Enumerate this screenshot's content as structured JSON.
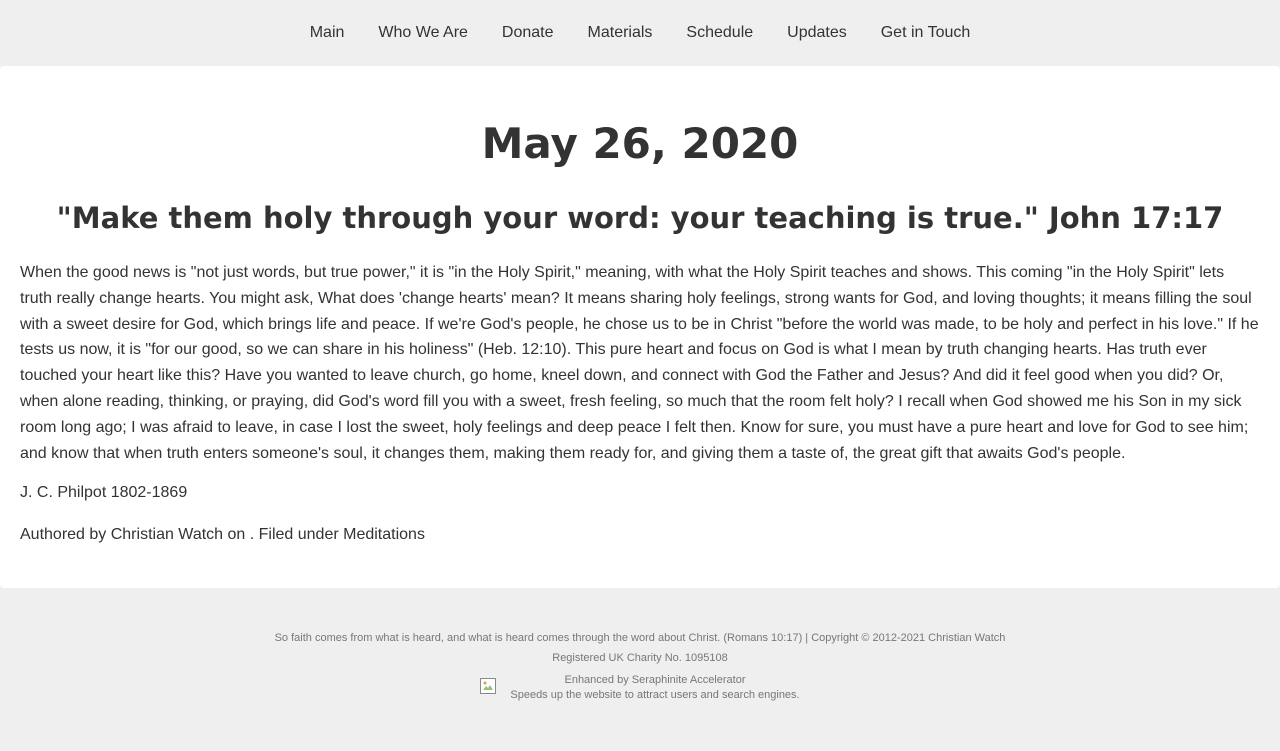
{
  "nav": {
    "items": [
      "Main",
      "Who We Are",
      "Donate",
      "Materials",
      "Schedule",
      "Updates",
      "Get in Touch"
    ]
  },
  "article": {
    "date": "May 26, 2020",
    "verse": "\"Make them holy through your word: your teaching is true.\" John 17:17",
    "body": "When the good news is \"not just words, but true power,\" it is \"in the Holy Spirit,\" meaning, with what the Holy Spirit teaches and shows. This coming \"in the Holy Spirit\" lets truth really change hearts. You might ask, What does 'change hearts' mean? It means sharing holy feelings, strong wants for God, and loving thoughts; it means filling the soul with a sweet desire for God, which brings life and peace. If we're God's people, he chose us to be in Christ \"before the world was made, to be holy and perfect in his love.\" If he tests us now, it is \"for our good, so we can share in his holiness\" (Heb. 12:10). This pure heart and focus on God is what I mean by truth changing hearts. Has truth ever touched your heart like this? Have you wanted to leave church, go home, kneel down, and connect with God the Father and Jesus? And did it feel good when you did? Or, when alone reading, thinking, or praying, did God's word fill you with a sweet, fresh feeling, so much that the room felt holy? I recall when God showed me his Son in my sick room long ago; I was afraid to leave, in case I lost the sweet, holy feelings and deep peace I felt then. Know for sure, you must have a pure heart and love for God to see him; and know that when truth enters someone's soul, it changes them, making them ready for, and giving them a taste of, the great gift that awaits God's people.",
    "author_line": "J. C. Philpot 1802-1869",
    "meta_line": "Authored by Christian Watch on . Filed under Meditations"
  },
  "footer": {
    "scripture_copyright": "So faith comes from what is heard, and what is heard comes through the word about Christ. (Romans 10:17) | Copyright © 2012-2021 Christian Watch",
    "charity": "Registered UK Charity No. 1095108",
    "badge_title": "Enhanced by Seraphinite Accelerator",
    "badge_subtitle": "Speeds up the website to attract users and search engines."
  },
  "colors": {
    "page_bg": "#efefef",
    "card_bg": "#ffffff",
    "text": "#333333",
    "footer_text": "#777777"
  },
  "icons": {
    "badge_image": "broken-image-icon"
  }
}
